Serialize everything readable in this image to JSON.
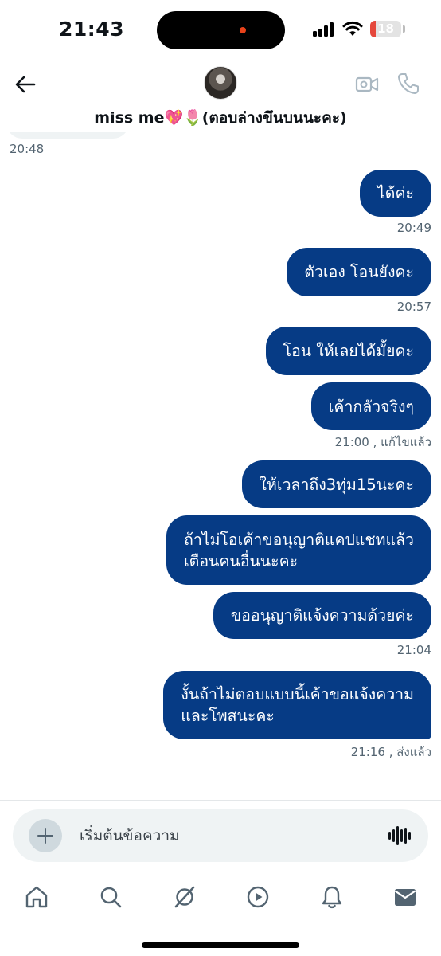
{
  "status_bar": {
    "time": "21:43",
    "battery_level": "18",
    "battery_fraction": 0.18,
    "colors": {
      "battery_low": "#e5483c",
      "recording_dot": "#e8421a"
    }
  },
  "header": {
    "title": "miss me💖🌷(ตอบล่างขึนบนนะคะ)",
    "icons": [
      "back-arrow-icon",
      "video-call-icon",
      "phone-call-icon"
    ]
  },
  "conversation": {
    "previous_timestamp": "20:48",
    "messages": [
      {
        "text": "ได้ค่ะ",
        "meta": "20:49"
      },
      {
        "text": "ตัวเอง โอนยังคะ",
        "meta": "20:57"
      },
      {
        "text": "โอน ให้เลยได้มั้ยคะ",
        "meta": ""
      },
      {
        "text": "เค้ากลัวจริงๆ",
        "meta": "21:00 , แก้ไขแล้ว"
      },
      {
        "text": "ให้เวลาถึง3ทุ่ม15นะคะ",
        "meta": ""
      },
      {
        "text": "ถ้าไม่โอเค้าขอนุญาติแคปแชทแล้ว\nเตือนคนอื่นนะคะ",
        "meta": ""
      },
      {
        "text": "ขออนุญาติแจ้งความด้วยค่ะ",
        "meta": "21:04"
      },
      {
        "text": "งั้นถ้าไม่ตอบแบบนี้เค้าขอแจ้งความ\nและโพสนะคะ",
        "meta": "21:16 , ส่งแล้ว"
      }
    ],
    "colors": {
      "outgoing_bubble": "#063b85",
      "meta_text": "#536471"
    }
  },
  "composer": {
    "placeholder": "เริ่มต้นข้อความ",
    "icons": [
      "add-media-icon",
      "voice-message-icon"
    ]
  },
  "bottom_nav": {
    "items": [
      "home-icon",
      "search-icon",
      "grok-icon",
      "video-icon",
      "notifications-icon",
      "messages-icon"
    ]
  }
}
